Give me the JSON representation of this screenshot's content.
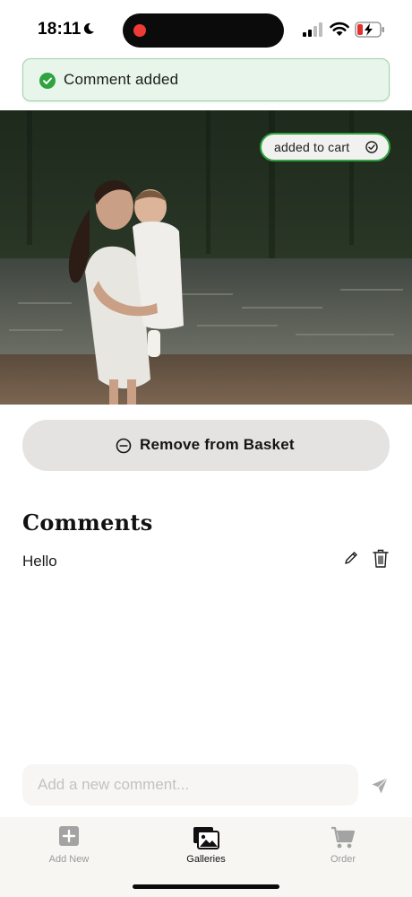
{
  "status_bar": {
    "time": "18:11",
    "icons": [
      "moon-icon",
      "recording-indicator",
      "signal-icon",
      "wifi-icon",
      "battery-charging-icon"
    ]
  },
  "toast": {
    "message": "Comment added",
    "icon": "check-circle-icon",
    "color": "#2fa33f"
  },
  "photo": {
    "badge_label": "added to cart",
    "badge_icon": "check-circle-outline-icon",
    "badge_color": "#2fa33f"
  },
  "actions": {
    "remove_label": "Remove from Basket",
    "remove_icon": "minus-circle-icon"
  },
  "comments": {
    "heading": "Comments",
    "items": [
      {
        "text": "Hello",
        "actions": [
          "pencil-icon",
          "trash-icon"
        ]
      }
    ]
  },
  "composer": {
    "placeholder": "Add a new comment...",
    "send_icon": "send-icon"
  },
  "tab_bar": {
    "tabs": [
      {
        "label": "Add New",
        "icon": "plus-square-icon",
        "active": false
      },
      {
        "label": "Galleries",
        "icon": "photo-gallery-icon",
        "active": true
      },
      {
        "label": "Order",
        "icon": "cart-icon",
        "active": false
      }
    ],
    "active_color": "#111111",
    "inactive_color": "#9a9a9a"
  }
}
